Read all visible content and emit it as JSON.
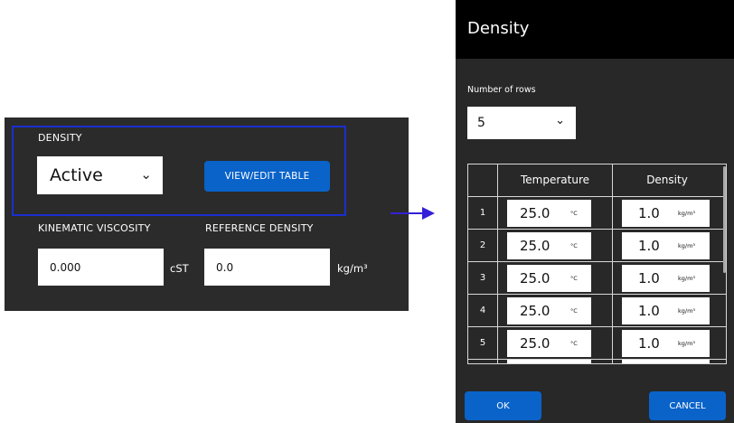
{
  "settings_panel": {
    "density_label": "DENSITY",
    "density_select": {
      "value": "Active",
      "icon": "chevron-down-icon"
    },
    "view_edit_button": "VIEW/EDIT TABLE",
    "kinematic_viscosity_label": "KINEMATIC VISCOSITY",
    "kinematic_viscosity_value": "0.000",
    "kinematic_viscosity_unit": "cST",
    "reference_density_label": "REFERENCE DENSITY",
    "reference_density_value": "0.0",
    "reference_density_unit": "kg/m³",
    "highlight_color": "#1a2fd0"
  },
  "arrow": {
    "icon": "arrow-right-icon",
    "color": "#3420d8"
  },
  "dialog": {
    "title": "Density",
    "rows_label": "Number of rows",
    "rows_select": {
      "value": "5",
      "icon": "chevron-down-icon"
    },
    "table": {
      "headers": [
        "Temperature",
        "Density"
      ],
      "rows": [
        {
          "index": "1",
          "temperature": "25.0",
          "temperature_unit": "°C",
          "density": "1.0",
          "density_unit": "kg/m³"
        },
        {
          "index": "2",
          "temperature": "25.0",
          "temperature_unit": "°C",
          "density": "1.0",
          "density_unit": "kg/m³"
        },
        {
          "index": "3",
          "temperature": "25.0",
          "temperature_unit": "°C",
          "density": "1.0",
          "density_unit": "kg/m³"
        },
        {
          "index": "4",
          "temperature": "25.0",
          "temperature_unit": "°C",
          "density": "1.0",
          "density_unit": "kg/m³"
        },
        {
          "index": "5",
          "temperature": "25.0",
          "temperature_unit": "°C",
          "density": "1.0",
          "density_unit": "kg/m³"
        }
      ]
    },
    "ok_button": "OK",
    "cancel_button": "CANCEL",
    "button_color": "#0a63c9"
  }
}
